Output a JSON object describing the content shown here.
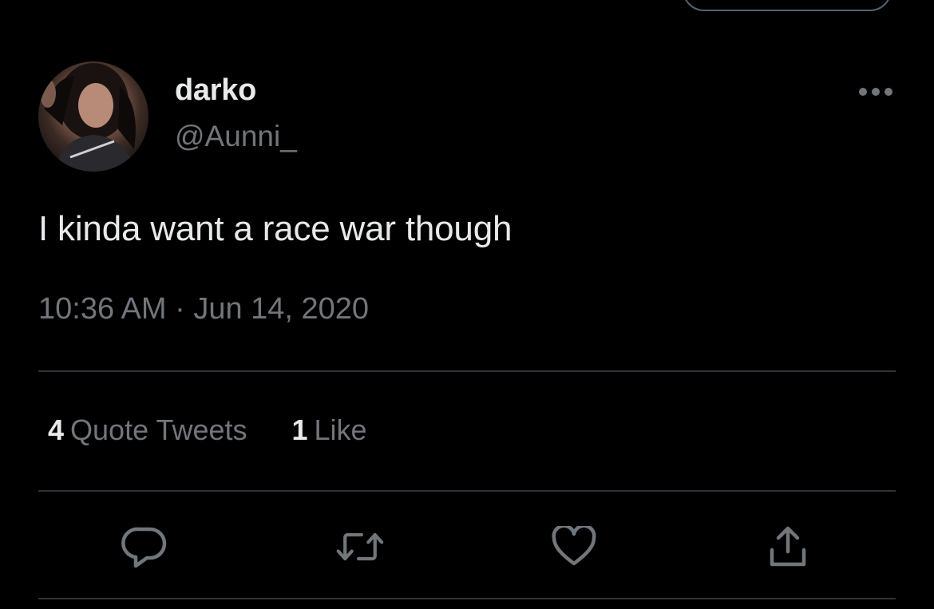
{
  "tweet": {
    "author": {
      "display_name": "darko",
      "handle": "@Aunni_"
    },
    "text": "I kinda want a race war though",
    "timestamp": "10:36 AM · Jun 14, 2020"
  },
  "stats": {
    "quote_tweets": {
      "count": "4",
      "label": "Quote Tweets"
    },
    "likes": {
      "count": "1",
      "label": "Like"
    }
  },
  "actions": {
    "reply": "reply-icon",
    "retweet": "retweet-icon",
    "like": "heart-icon",
    "share": "share-icon"
  },
  "colors": {
    "background": "#000000",
    "primary_text": "#e7e9ea",
    "secondary_text": "#71767b",
    "divider": "#2f3336"
  }
}
